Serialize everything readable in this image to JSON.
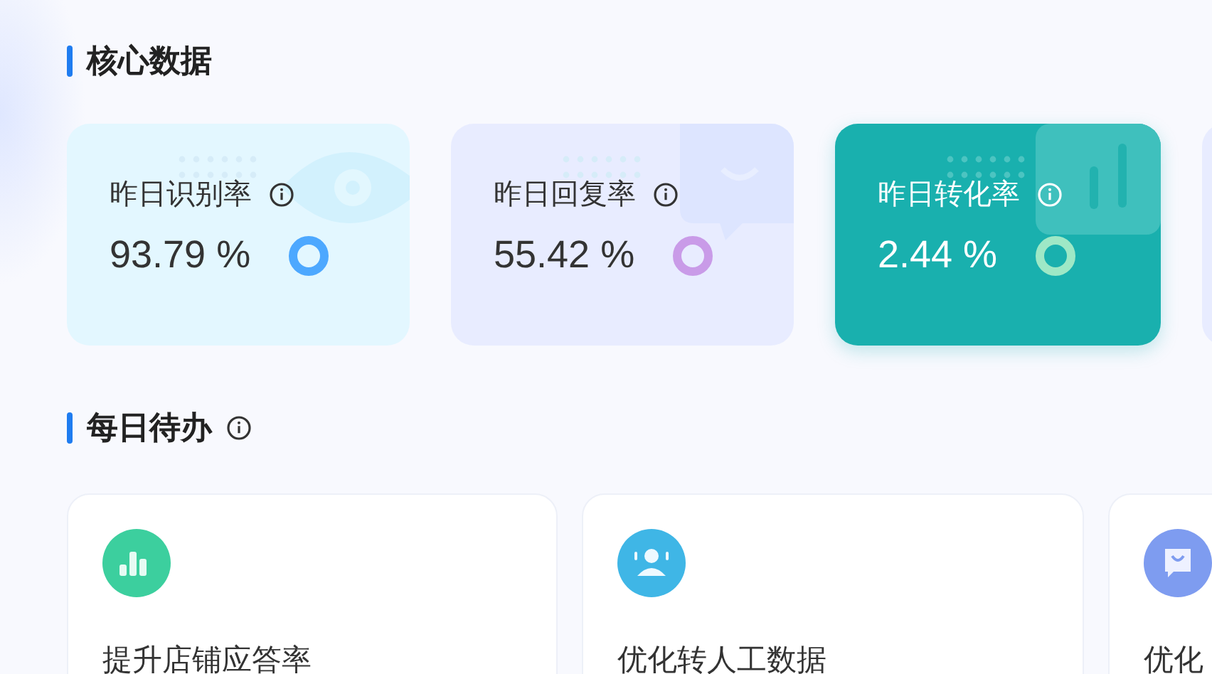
{
  "core_section": {
    "title": "核心数据"
  },
  "stat_cards": [
    {
      "label": "昨日识别率",
      "value": "93.79 %",
      "color": "#4da8ff",
      "selected": false,
      "kind": "eye"
    },
    {
      "label": "昨日回复率",
      "value": "55.42 %",
      "color": "#c99be8",
      "selected": false,
      "kind": "chat"
    },
    {
      "label": "昨日转化率",
      "value": "2.44 %",
      "color": "#9ee8c6",
      "selected": true,
      "kind": "bars"
    },
    {
      "kind": "empty",
      "selected": false
    }
  ],
  "todo_section": {
    "title": "每日待办"
  },
  "todo_cards": [
    {
      "title": "提升店铺应答率",
      "kind": "bars",
      "color": "#3ccf9e"
    },
    {
      "title": "优化转人工数据",
      "kind": "agent",
      "color": "#3fb6e6"
    },
    {
      "title": "优化",
      "kind": "bag",
      "color": "#7e9cf0"
    }
  ]
}
